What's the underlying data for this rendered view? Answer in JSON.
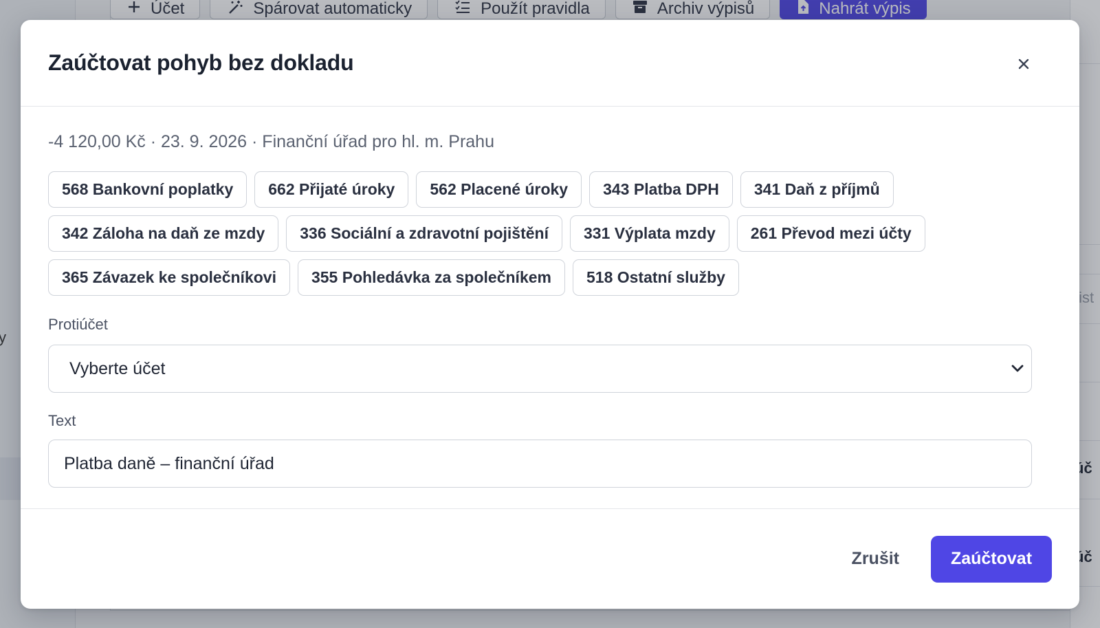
{
  "background": {
    "toolbar": [
      {
        "icon": "plus-icon",
        "label": "Účet"
      },
      {
        "icon": "magic-wand-icon",
        "label": "Spárovat automaticky"
      },
      {
        "icon": "checklist-icon",
        "label": "Použít pravidla"
      },
      {
        "icon": "archive-icon",
        "label": "Archiv výpisů"
      },
      {
        "icon": "upload-file-icon",
        "label": "Nahrát výpis"
      }
    ],
    "right_snippets": [
      "tist",
      "úč",
      "úč"
    ],
    "sidebar_fragment": "y"
  },
  "modal": {
    "title": "Zaúčtovat pohyb bez dokladu",
    "close_label": "×",
    "summary": "-4 120,00 Kč · 23. 9. 2026 · Finanční úřad pro hl. m. Prahu",
    "chips": [
      "568 Bankovní poplatky",
      "662 Přijaté úroky",
      "562 Placené úroky",
      "343 Platba DPH",
      "341 Daň z příjmů",
      "342 Záloha na daň ze mzdy",
      "336 Sociální a zdravotní pojištění",
      "331 Výplata mzdy",
      "261 Převod mezi účty",
      "365 Závazek ke společníkovi",
      "355 Pohledávka za společníkem",
      "518 Ostatní služby"
    ],
    "counter_account": {
      "label": "Protiúčet",
      "selected": "Vyberte účet"
    },
    "text_field": {
      "label": "Text",
      "value": "Platba daně – finanční úřad"
    },
    "footer": {
      "cancel_label": "Zrušit",
      "submit_label": "Zaúčtovat"
    }
  },
  "colors": {
    "accent": "#4f46e5",
    "overlay": "#282e3a"
  }
}
